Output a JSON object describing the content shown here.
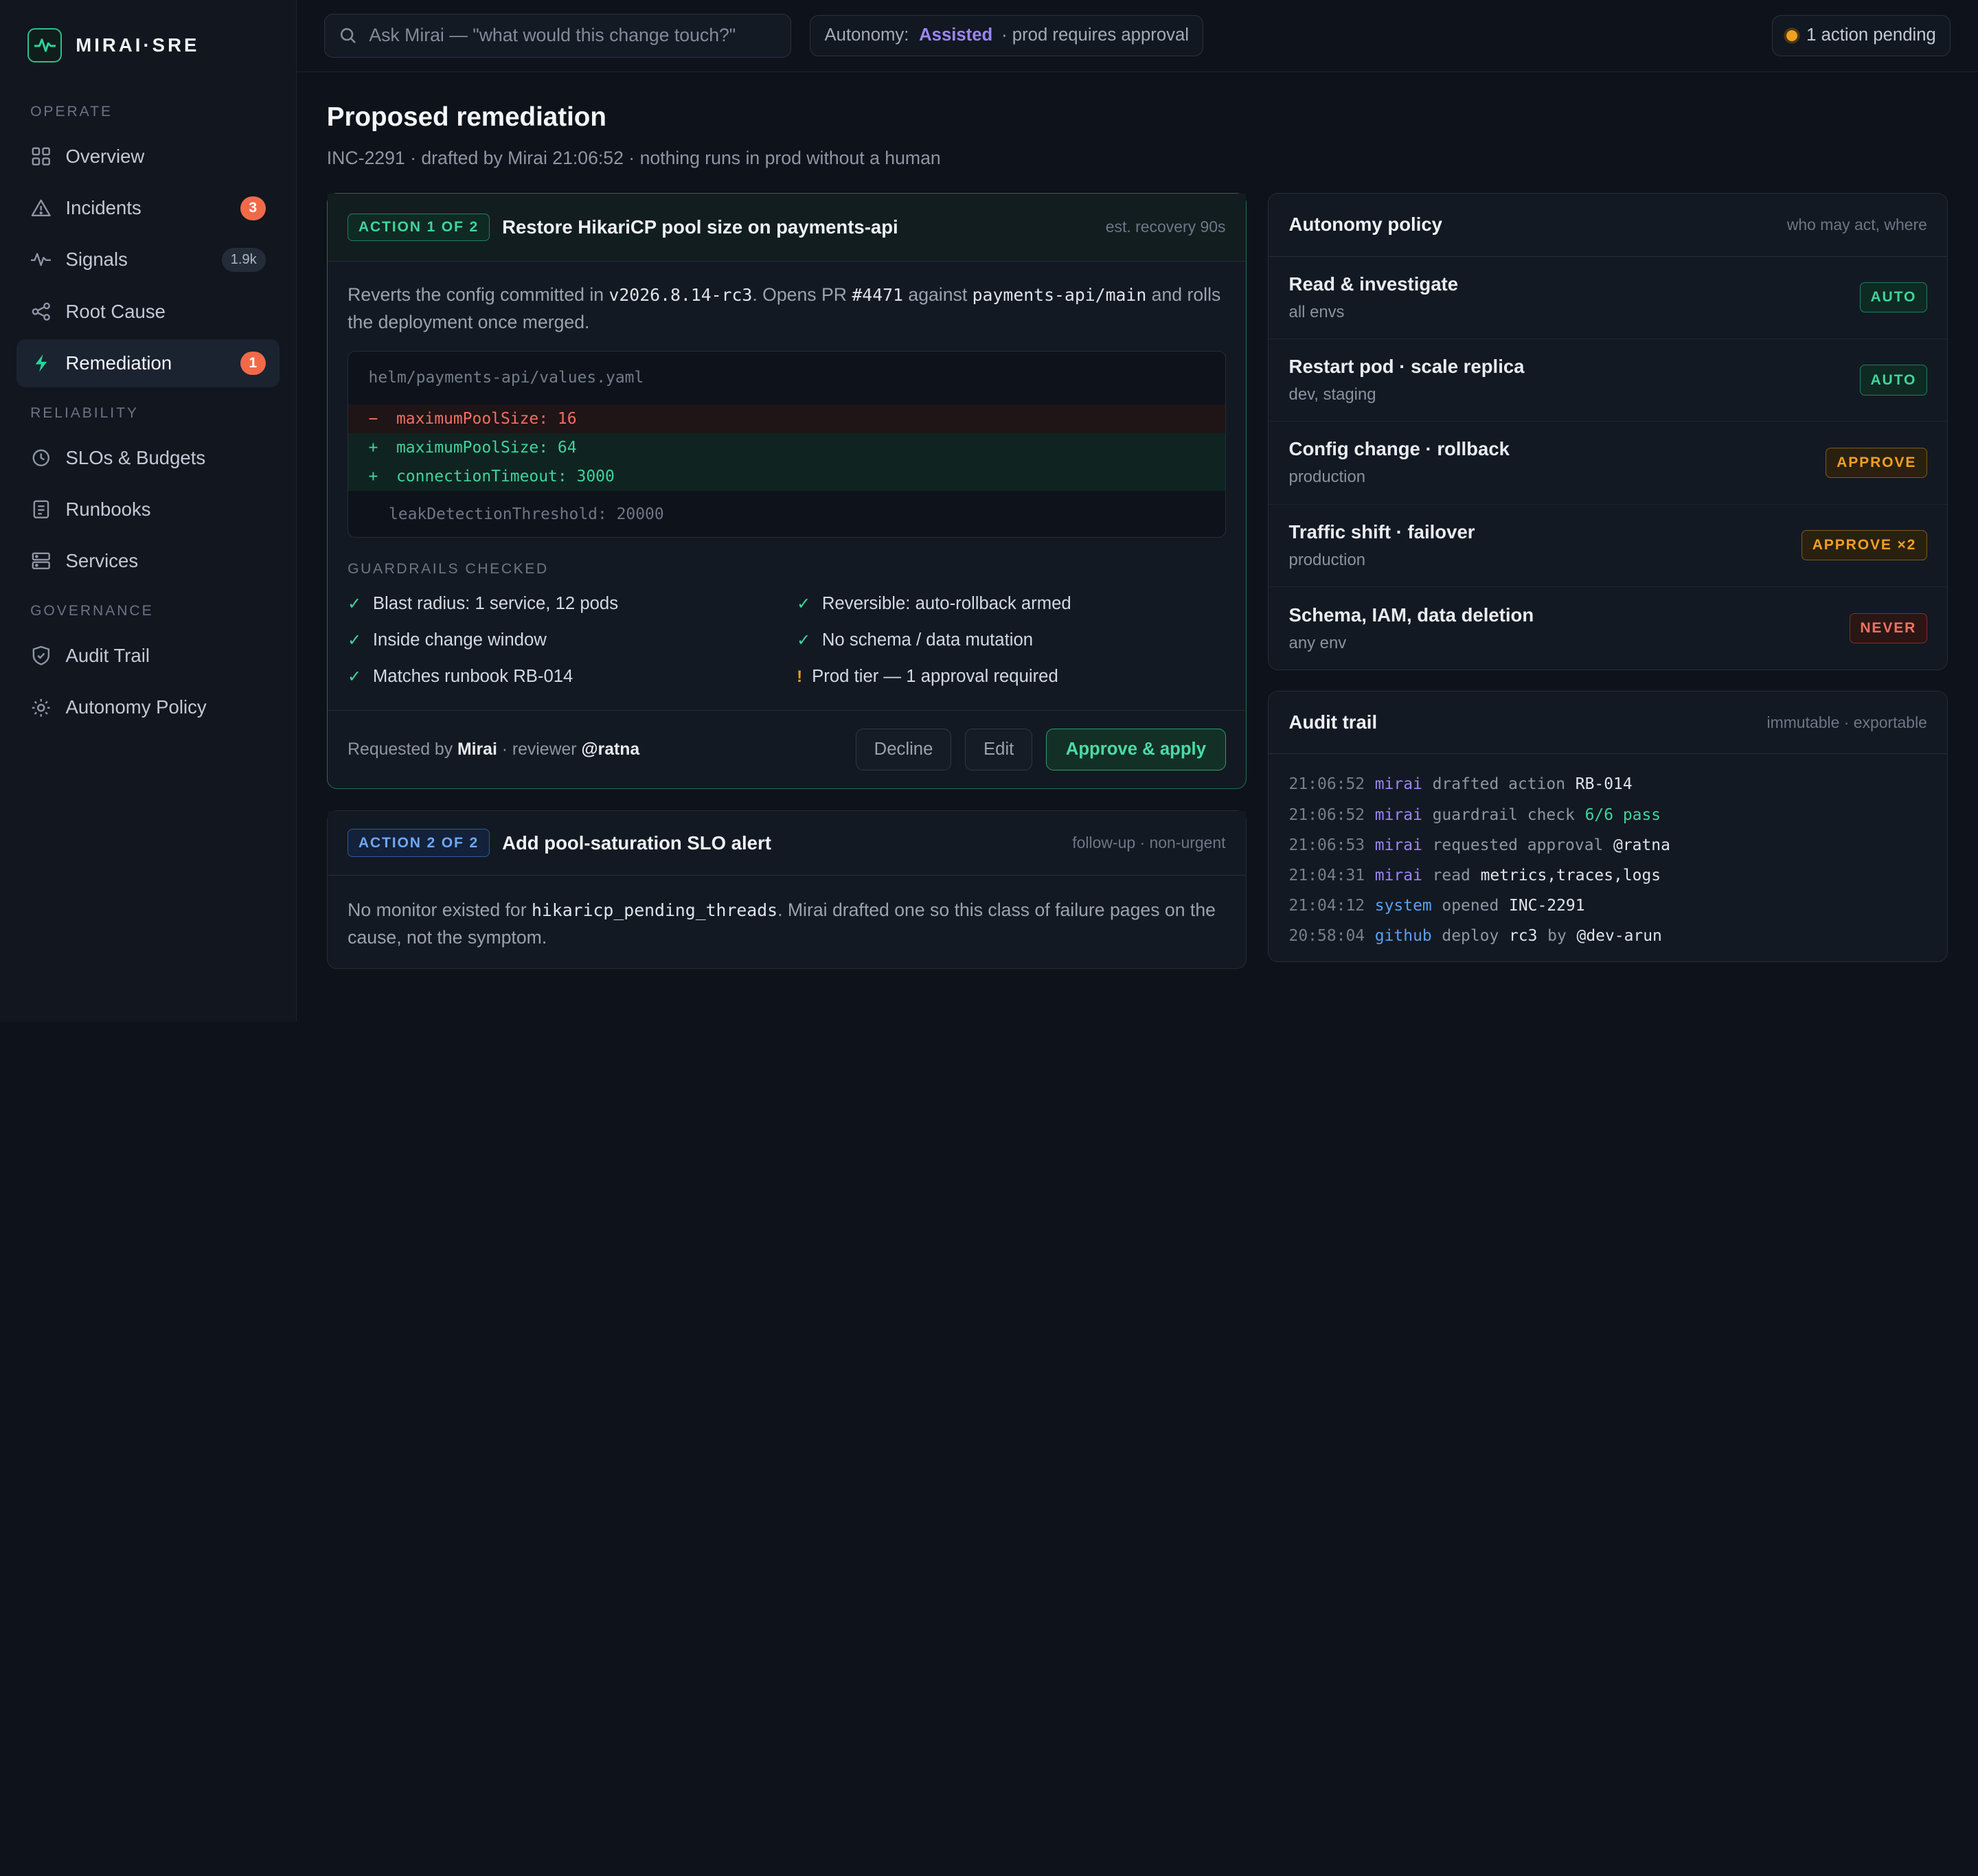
{
  "brand": {
    "name": "MIRAI·SRE",
    "logo_icon": "pulse-icon",
    "accent": "#2bbf8a"
  },
  "sidebar": {
    "sections": [
      {
        "title": "OPERATE",
        "items": [
          {
            "label": "Overview",
            "icon": "grid-icon"
          },
          {
            "label": "Incidents",
            "icon": "warning-triangle-icon",
            "badge": "3"
          },
          {
            "label": "Signals",
            "icon": "activity-icon",
            "count": "1.9k"
          },
          {
            "label": "Root Cause",
            "icon": "share-nodes-icon"
          },
          {
            "label": "Remediation",
            "icon": "lightning-icon",
            "badge": "1",
            "active": true
          }
        ]
      },
      {
        "title": "RELIABILITY",
        "items": [
          {
            "label": "SLOs & Budgets",
            "icon": "clock-icon"
          },
          {
            "label": "Runbooks",
            "icon": "document-icon"
          },
          {
            "label": "Services",
            "icon": "server-icon"
          }
        ]
      },
      {
        "title": "GOVERNANCE",
        "items": [
          {
            "label": "Audit Trail",
            "icon": "shield-check-icon"
          },
          {
            "label": "Autonomy Policy",
            "icon": "sun-gear-icon"
          }
        ]
      }
    ]
  },
  "topbar": {
    "search_placeholder": "Ask Mirai — \"what would this change touch?\"",
    "autonomy_label": "Autonomy:",
    "autonomy_value": "Assisted",
    "autonomy_note": "· prod requires approval",
    "pending": "1 action pending"
  },
  "page": {
    "title": "Proposed remediation",
    "subtitle": "INC-2291 · drafted by Mirai 21:06:52 · nothing runs in prod without a human"
  },
  "action1": {
    "tag": "ACTION 1 OF 2",
    "title": "Restore HikariCP pool size on payments-api",
    "meta": "est. recovery 90s",
    "desc": {
      "t1": "Reverts the config committed in ",
      "c1": "v2026.8.14-rc3",
      "t2": ". Opens PR ",
      "c2": "#4471",
      "t3": " against ",
      "c3": "payments-api/main",
      "t4": " and rolls the deployment once merged."
    },
    "diff": {
      "file": "helm/payments-api/values.yaml",
      "del": [
        {
          "sign": "−",
          "text": "maximumPoolSize: 16"
        }
      ],
      "add": [
        {
          "sign": "+",
          "text": "maximumPoolSize: 64"
        },
        {
          "sign": "+",
          "text": "connectionTimeout: 3000"
        }
      ],
      "ctx": "leakDetectionThreshold: 20000"
    },
    "guardrails_title": "GUARDRAILS CHECKED",
    "guardrails": [
      {
        "mark": "✓",
        "text": "Blast radius: 1 service, 12 pods"
      },
      {
        "mark": "✓",
        "text": "Reversible: auto-rollback armed"
      },
      {
        "mark": "✓",
        "text": "Inside change window"
      },
      {
        "mark": "✓",
        "text": "No schema / data mutation"
      },
      {
        "mark": "✓",
        "text": "Matches runbook RB-014"
      },
      {
        "mark": "!",
        "text": "Prod tier — 1 approval required"
      }
    ],
    "requested_by_label": "Requested by",
    "requested_by": "Mirai",
    "reviewer_label": "· reviewer",
    "reviewer": "@ratna",
    "decline": "Decline",
    "edit": "Edit",
    "approve": "Approve & apply"
  },
  "action2": {
    "tag": "ACTION 2 OF 2",
    "title": "Add pool-saturation SLO alert",
    "meta": "follow-up · non-urgent",
    "desc": {
      "t1": "No monitor existed for ",
      "c1": "hikaricp_pending_threads",
      "t2": ". Mirai drafted one so this class of failure pages on the cause, not the symptom."
    }
  },
  "policy": {
    "title": "Autonomy policy",
    "meta": "who may act, where",
    "rows": [
      {
        "name": "Read & investigate",
        "scope": "all envs",
        "badge": "AUTO",
        "kind": "auto"
      },
      {
        "name": "Restart pod · scale replica",
        "scope": "dev, staging",
        "badge": "AUTO",
        "kind": "auto"
      },
      {
        "name": "Config change · rollback",
        "scope": "production",
        "badge": "APPROVE",
        "kind": "approve"
      },
      {
        "name": "Traffic shift · failover",
        "scope": "production",
        "badge": "APPROVE ×2",
        "kind": "approve"
      },
      {
        "name": "Schema, IAM, data deletion",
        "scope": "any env",
        "badge": "NEVER",
        "kind": "never"
      }
    ]
  },
  "audit": {
    "title": "Audit trail",
    "meta": "immutable · exportable",
    "rows": [
      {
        "time": "21:06:52",
        "actor": "mirai",
        "verb": "drafted action",
        "obj": "RB-014",
        "ok": ""
      },
      {
        "time": "21:06:52",
        "actor": "mirai",
        "verb": "guardrail check",
        "obj": "",
        "ok": "6/6 pass"
      },
      {
        "time": "21:06:53",
        "actor": "mirai",
        "verb": "requested approval",
        "obj": "@ratna",
        "ok": ""
      },
      {
        "time": "21:04:31",
        "actor": "mirai",
        "verb": "read",
        "obj": "metrics,traces,logs",
        "ok": ""
      },
      {
        "time": "21:04:12",
        "actor": "system",
        "verb": "opened",
        "obj": "INC-2291",
        "ok": ""
      },
      {
        "time": "20:58:04",
        "actor": "github",
        "verb": "deploy",
        "obj": "rc3",
        "verb2": "by",
        "obj2": "@dev-arun",
        "ok": ""
      }
    ]
  }
}
